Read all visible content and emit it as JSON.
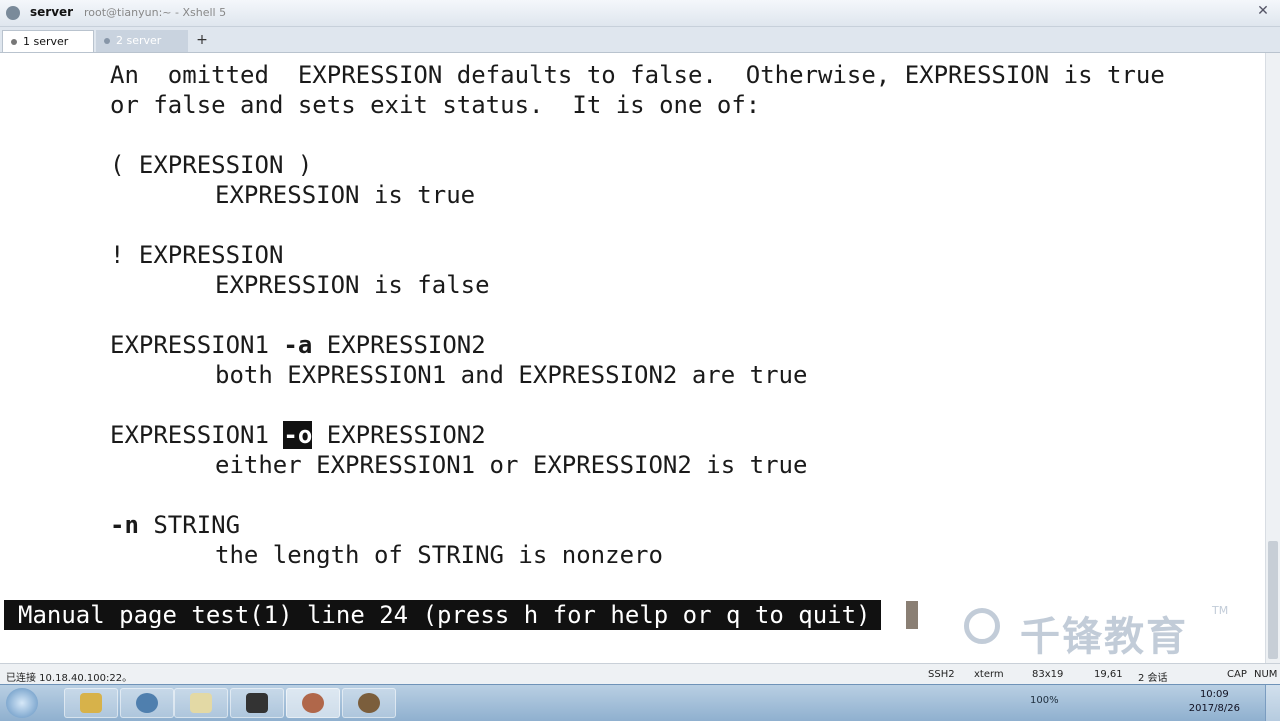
{
  "window": {
    "title": "server",
    "subtitle": "root@tianyun:~ - Xshell 5"
  },
  "tabs": [
    {
      "label": "1 server"
    },
    {
      "label": "2 server"
    }
  ],
  "new_tab_label": "+",
  "close_label": "✕",
  "terminal": {
    "l1": "An  omitted  EXPRESSION defaults to false.  Otherwise, EXPRESSION is true",
    "l2": "or false and sets exit status.  It is one of:",
    "l3": "( EXPRESSION )",
    "l4": "EXPRESSION is true",
    "l5": "! EXPRESSION",
    "l6": "EXPRESSION is false",
    "l7a": "EXPRESSION1 ",
    "l7b": "-a",
    "l7c": " EXPRESSION2",
    "l8": "both EXPRESSION1 and EXPRESSION2 are true",
    "l9a": "EXPRESSION1 ",
    "l9b": "-o",
    "l9c": " EXPRESSION2",
    "l10": "either EXPRESSION1 or EXPRESSION2 is true",
    "l11a": "-n",
    "l11b": " STRING",
    "l12": "the length of STRING is nonzero",
    "status": "Manual page test(1) line 24 (press h for help or q to quit)"
  },
  "watermark": {
    "text": "千锋教育",
    "tm": "TM"
  },
  "statusbar": {
    "connection": "已连接 10.18.40.100:22。",
    "protocol": "SSH2",
    "term_type": "xterm",
    "size": "83x19",
    "cursor": "19,61",
    "sessions": "2 会话",
    "cap": "CAP",
    "num": "NUM"
  },
  "taskbar": {
    "clock_time": "10:09",
    "clock_date": "2017/8/26",
    "tray_volume": "100%"
  }
}
